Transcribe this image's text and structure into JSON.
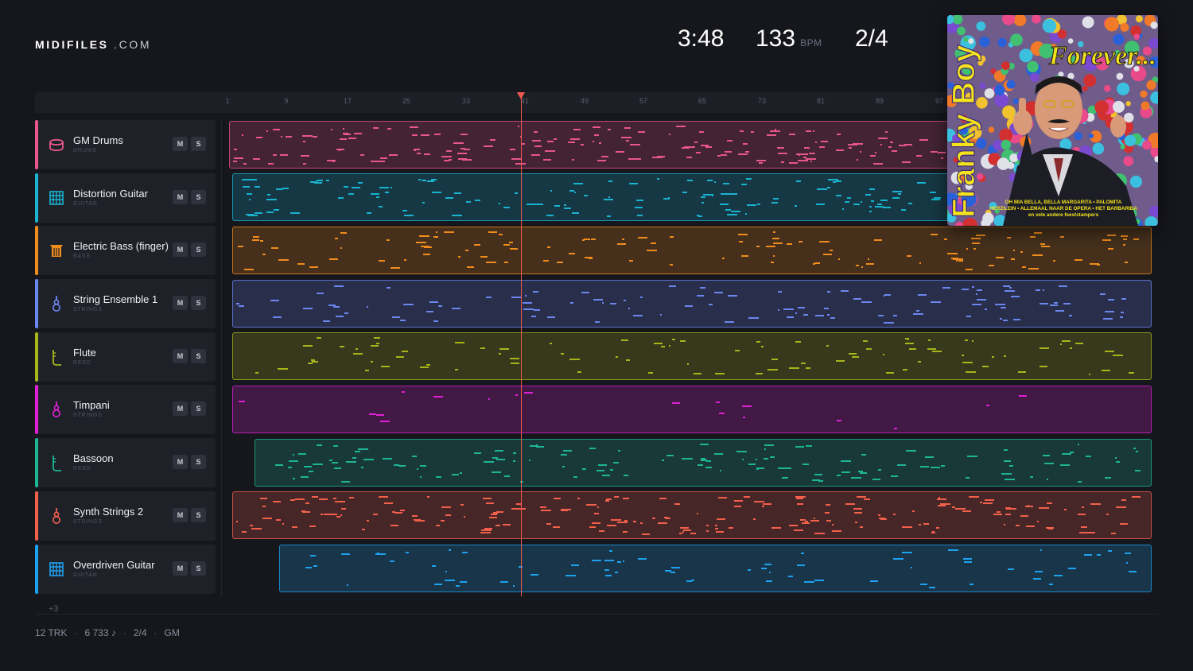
{
  "header": {
    "logo_bold": "MIDIFILES",
    "logo_suffix": ".COM",
    "time": "3:48",
    "tempo": "133",
    "tempo_unit": "BPM",
    "meter": "2/4"
  },
  "ruler": {
    "ticks": [
      "1",
      "9",
      "17",
      "25",
      "33",
      "41",
      "49",
      "57",
      "65",
      "73",
      "81",
      "89",
      "97"
    ]
  },
  "tracks": [
    {
      "name": "GM Drums",
      "category": "DRUMS",
      "color": "#e8568a",
      "icon": "drum-icon",
      "mute": "M",
      "solo": "S"
    },
    {
      "name": "Distortion Guitar",
      "category": "GUITAR",
      "color": "#19b3d1",
      "icon": "guitar-icon",
      "mute": "M",
      "solo": "S"
    },
    {
      "name": "Electric Bass (finger)",
      "category": "BASS",
      "color": "#f08c1c",
      "icon": "bass-icon",
      "mute": "M",
      "solo": "S"
    },
    {
      "name": "String Ensemble 1",
      "category": "STRINGS",
      "color": "#6c86f0",
      "icon": "violin-icon",
      "mute": "M",
      "solo": "S"
    },
    {
      "name": "Flute",
      "category": "REED",
      "color": "#a7b51a",
      "icon": "flute-icon",
      "mute": "M",
      "solo": "S"
    },
    {
      "name": "Timpani",
      "category": "STRINGS",
      "color": "#e020d6",
      "icon": "timpani-icon",
      "mute": "M",
      "solo": "S"
    },
    {
      "name": "Bassoon",
      "category": "REED",
      "color": "#1eb594",
      "icon": "bassoon-icon",
      "mute": "M",
      "solo": "S"
    },
    {
      "name": "Synth Strings 2",
      "category": "STRINGS",
      "color": "#f2604c",
      "icon": "synth-strings-icon",
      "mute": "M",
      "solo": "S"
    },
    {
      "name": "Overdriven Guitar",
      "category": "GUITAR",
      "color": "#1ea2ef",
      "icon": "guitar-icon",
      "mute": "M",
      "solo": "S"
    }
  ],
  "more_tracks": "+3",
  "footer": {
    "tracks": "12 TRK",
    "notes": "6 733 ♪",
    "meter": "2/4",
    "standard": "GM"
  },
  "album": {
    "artist": "Franky Boy",
    "title": "Forever...",
    "songs_line1": "OH MIA BELLA, BELLA MARGARITA • PALOMITA",
    "songs_line2": "HERZILEIN • ALLEMAAL NAAR DE OPERA • HET BARBARIBA",
    "songs_line3": "en vele andere feeststampers"
  },
  "colors": {
    "background": "#16171d",
    "playhead": "#f05a4e"
  }
}
